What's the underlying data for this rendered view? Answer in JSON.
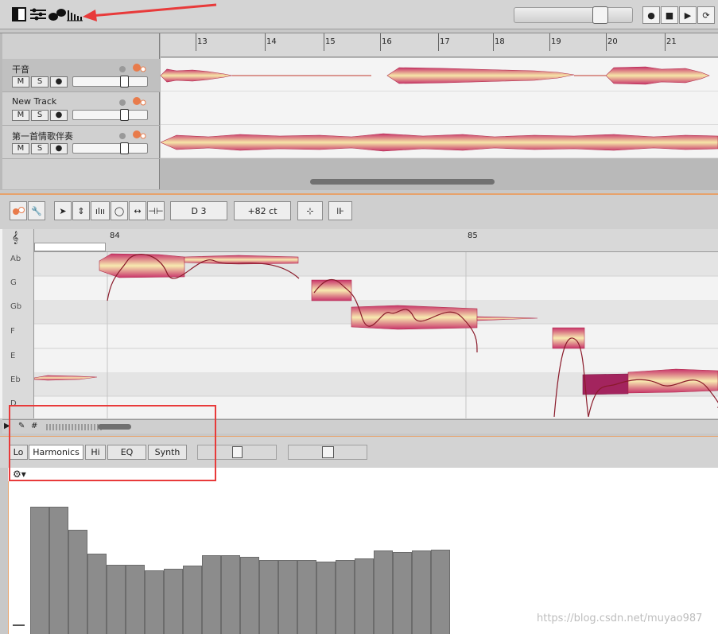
{
  "toolbar": {
    "icons": [
      "panel-toggle-icon",
      "tracks-icon",
      "notes-icon",
      "harmonics-icon"
    ],
    "transport": [
      "record-icon",
      "stop-icon",
      "play-icon",
      "loop-icon"
    ]
  },
  "tracks": [
    {
      "name": "干音",
      "m": "M",
      "s": "S",
      "volume": 0.7
    },
    {
      "name": "New Track",
      "m": "M",
      "s": "S",
      "volume": 0.7
    },
    {
      "name": "第一首情歌伴奏",
      "m": "M",
      "s": "S",
      "volume": 0.7
    }
  ],
  "timeline": {
    "bars": [
      "13",
      "14",
      "15",
      "16",
      "17",
      "18",
      "19",
      "20",
      "21"
    ]
  },
  "editor": {
    "pitch_value": "D 3",
    "cents_value": "+82 ct",
    "ruler": [
      "84",
      "85"
    ],
    "pitches": [
      "Ab",
      "G",
      "Gb",
      "F",
      "E",
      "Eb",
      "D"
    ]
  },
  "harmonics_panel": {
    "tabs": [
      "Lo",
      "Harmonics",
      "Hi",
      "EQ",
      "Synth"
    ],
    "active_tab": "Harmonics",
    "bars": [
      0.84,
      0.84,
      0.69,
      0.53,
      0.46,
      0.46,
      0.42,
      0.43,
      0.45,
      0.52,
      0.52,
      0.51,
      0.49,
      0.49,
      0.49,
      0.48,
      0.49,
      0.5,
      0.55,
      0.54,
      0.55,
      0.56
    ]
  },
  "watermark": "https://blog.csdn.net/muyao987",
  "colors": {
    "accent": "#e7a26b",
    "highlight": "#e83a3a",
    "waveform": "#d97a3a"
  }
}
